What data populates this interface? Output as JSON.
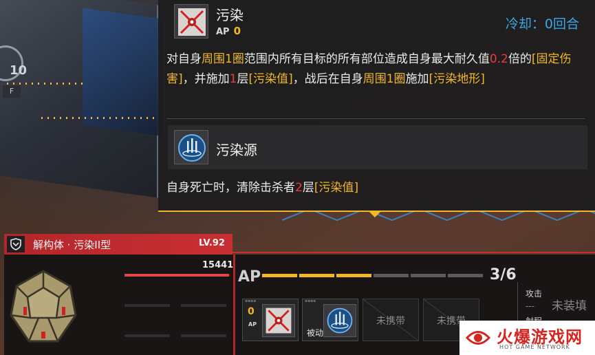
{
  "hud": {
    "counter": "10",
    "flag": "F"
  },
  "tooltip": {
    "skill": {
      "name": "污染",
      "ap_label": "AP",
      "ap_value": "0",
      "cooldown": "冷却：0回合",
      "icon": "contamination-burst-icon",
      "desc": [
        {
          "t": "对自身",
          "c": ""
        },
        {
          "t": "周围1圈",
          "c": "y"
        },
        {
          "t": "范围内所有目标的所有部位造成自身最大耐久值",
          "c": ""
        },
        {
          "t": "0.2",
          "c": "r"
        },
        {
          "t": "倍的",
          "c": ""
        },
        {
          "t": "[固定伤害]",
          "c": "y"
        },
        {
          "t": "，并施加",
          "c": ""
        },
        {
          "t": "1",
          "c": "r"
        },
        {
          "t": "层",
          "c": ""
        },
        {
          "t": "[污染值]",
          "c": "y"
        },
        {
          "t": "，战后在自身",
          "c": ""
        },
        {
          "t": "周围1圈",
          "c": "y"
        },
        {
          "t": "施加",
          "c": ""
        },
        {
          "t": "[污染地形]",
          "c": "y"
        }
      ]
    },
    "passive": {
      "name": "污染源",
      "icon": "contamination-source-icon",
      "desc": [
        {
          "t": "自身死亡时，清除击杀者",
          "c": ""
        },
        {
          "t": "2",
          "c": "r"
        },
        {
          "t": "层",
          "c": ""
        },
        {
          "t": "[污染值]",
          "c": "y"
        }
      ]
    }
  },
  "unit": {
    "badge_icon": "shield-icon",
    "name": "解构体 · 污染II型",
    "level": "LV.92",
    "hp": "15441",
    "hp_fraction": 1.0,
    "ap_label": "AP",
    "ap_value": "3/6",
    "ap_current": 3,
    "ap_max": 6,
    "slots": [
      {
        "kind": "active",
        "cost": "0",
        "cost_label": "AP",
        "icon": "contamination-burst-icon"
      },
      {
        "kind": "passive",
        "label": "被动",
        "icon": "contamination-source-icon"
      },
      {
        "kind": "empty",
        "label": "未携带"
      },
      {
        "kind": "empty",
        "label": "未携带"
      }
    ],
    "weapon": {
      "attack_label": "攻击",
      "attack_value": "---",
      "range_label": "射程",
      "status": "未装填"
    }
  },
  "colors": {
    "accent_yellow": "#f3b728",
    "accent_red": "#c82f33",
    "cooldown_blue": "#3aa8e6",
    "damage_red": "#ef3b3b"
  },
  "watermark": {
    "title": "火爆游戏网",
    "subtitle": "HOT GAME NETWORK"
  }
}
